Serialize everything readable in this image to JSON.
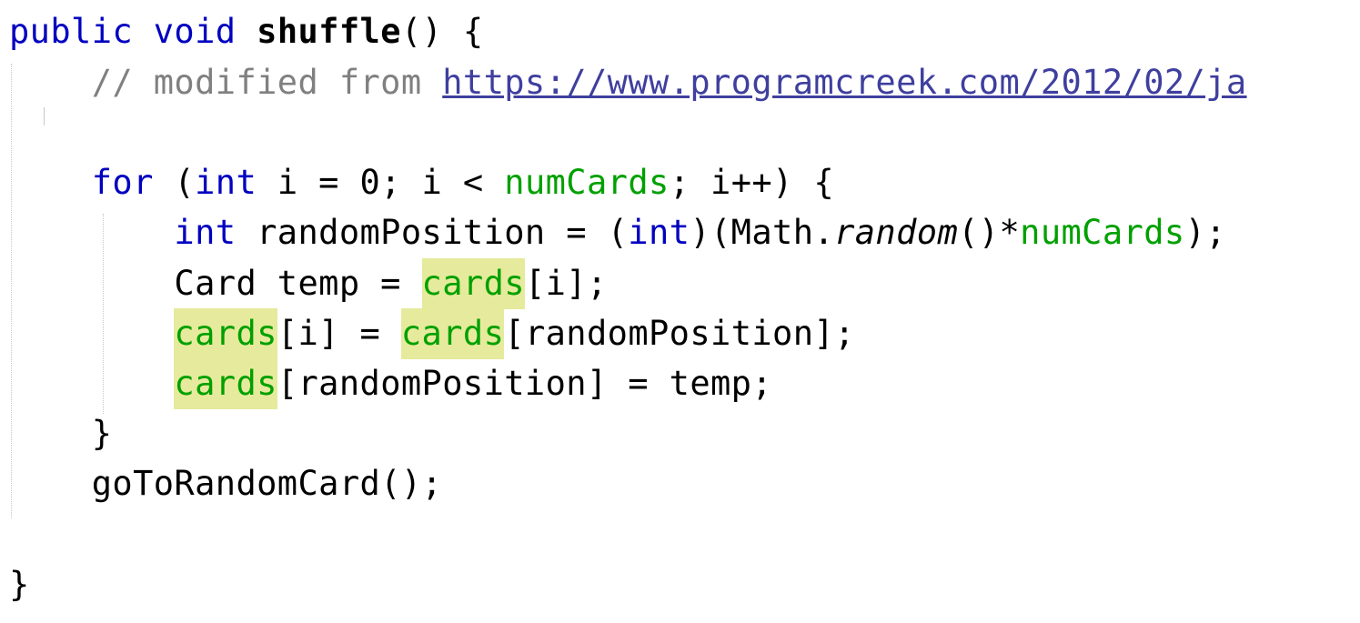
{
  "code": {
    "line1": {
      "kw_public": "public",
      "kw_void": "void",
      "method_name": "shuffle",
      "rest": "() {"
    },
    "line2": {
      "comment_prefix": "// modified from ",
      "comment_link": "https://www.programcreek.com/2012/02/ja"
    },
    "line4": {
      "kw_for": "for",
      "open": " (",
      "kw_int": "int",
      "init": " i = 0; i < ",
      "field": "numCards",
      "rest": "; i++) {"
    },
    "line5": {
      "kw_int": "int",
      "mid": " randomPosition = (",
      "kw_int2": "int",
      "math": ")(Math.",
      "random": "random",
      "call": "()*",
      "field": "numCards",
      "end": ");"
    },
    "line6": {
      "start": "Card temp = ",
      "field": "cards",
      "end": "[i];"
    },
    "line7": {
      "field1": "cards",
      "mid": "[i] = ",
      "field2": "cards",
      "end": "[randomPosition];"
    },
    "line8": {
      "field": "cards",
      "end": "[randomPosition] = temp;"
    },
    "line9": {
      "brace": "}"
    },
    "line10": {
      "call": "goToRandomCard();"
    },
    "line12": {
      "brace": "}"
    }
  },
  "colors": {
    "keyword": "#0000c0",
    "comment": "#808080",
    "field": "#00a000",
    "highlight": "#e6ea9c",
    "link": "#3f3f9f"
  }
}
